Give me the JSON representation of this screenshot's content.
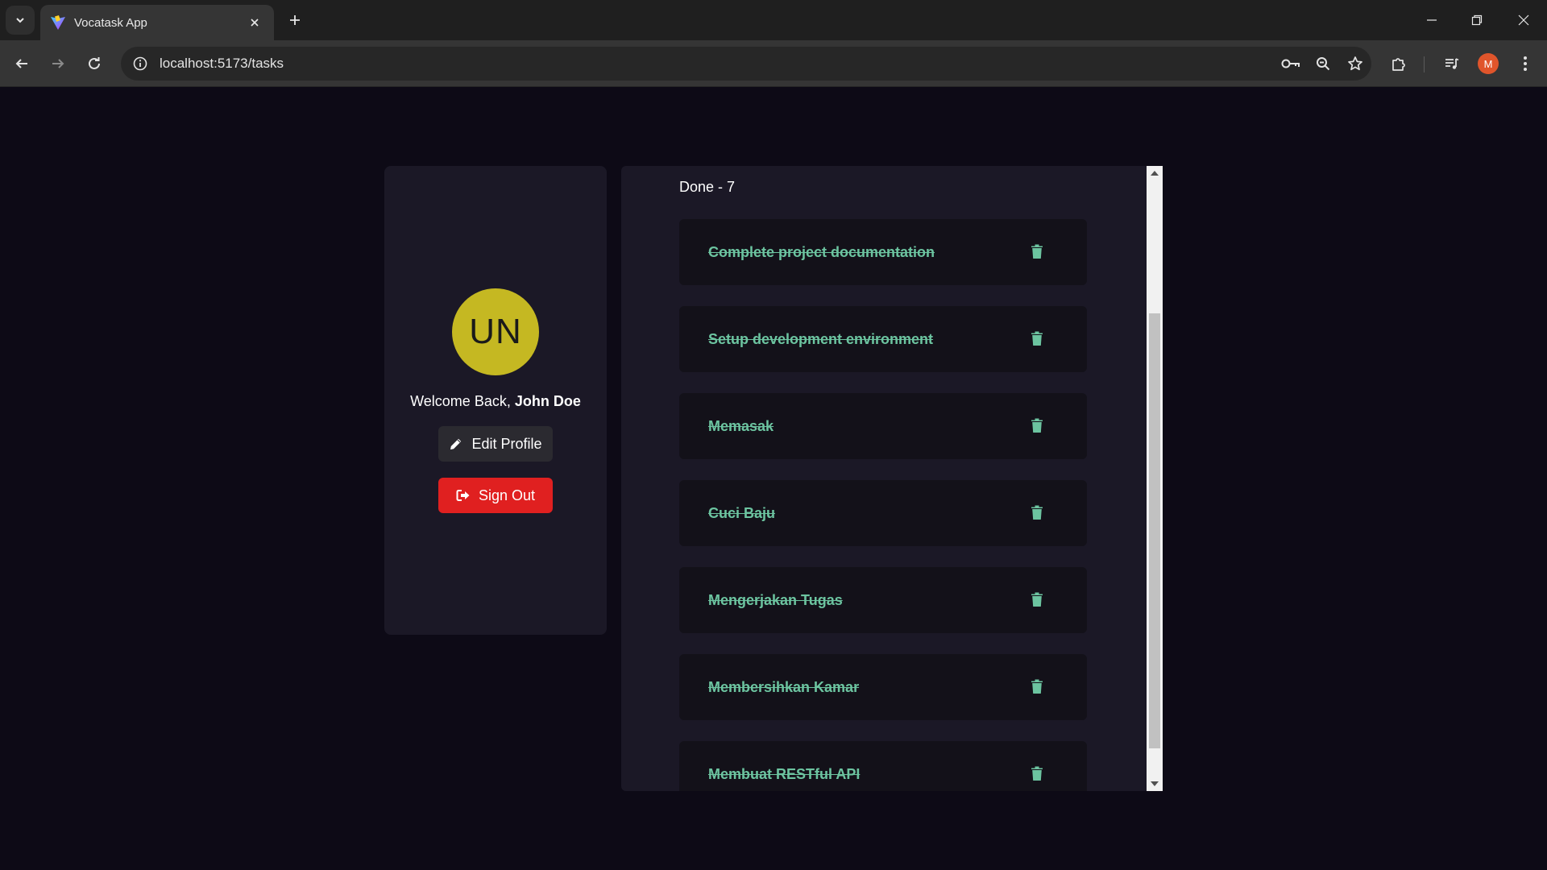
{
  "browser": {
    "tab_title": "Vocatask App",
    "url": "localhost:5173/tasks",
    "profile_initial": "M",
    "icons": {
      "tab_list": "chevron-down-icon",
      "tab_close": "close-icon",
      "new_tab": "plus-icon",
      "back": "back-arrow-icon",
      "forward": "forward-arrow-icon",
      "reload": "reload-icon",
      "site_info": "site-info-icon",
      "password": "key-icon",
      "zoom": "zoom-icon",
      "bookmark": "star-icon",
      "extensions": "puzzle-icon",
      "media": "media-control-icon",
      "menu": "kebab-menu-icon"
    }
  },
  "profile": {
    "initials": "UN",
    "welcome_prefix": "Welcome Back, ",
    "user_name": "John Doe",
    "edit_label": "Edit Profile",
    "signout_label": "Sign Out",
    "avatar_color": "#c5b822",
    "signout_color": "#e02020"
  },
  "tasks": {
    "section_title": "Done - 7",
    "accent_color": "#6cc4a0",
    "items": [
      {
        "label": "Complete project documentation"
      },
      {
        "label": "Setup development environment"
      },
      {
        "label": "Memasak"
      },
      {
        "label": "Cuci Baju"
      },
      {
        "label": "Mengerjakan Tugas"
      },
      {
        "label": "Membersihkan Kamar"
      },
      {
        "label": "Membuat RESTful API"
      }
    ]
  }
}
